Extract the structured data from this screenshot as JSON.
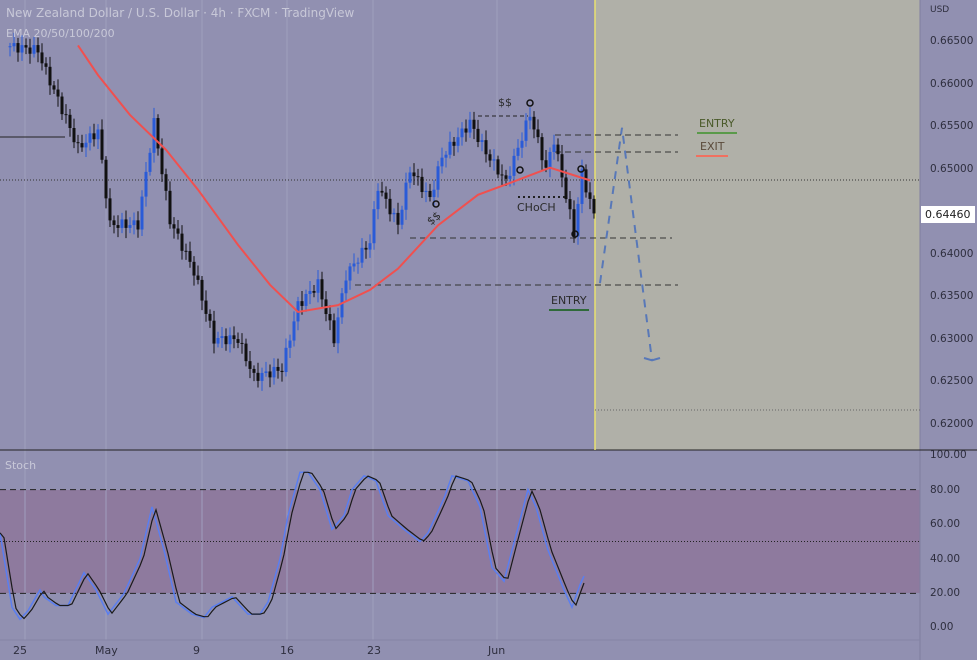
{
  "header": {
    "title": "New Zealand Dollar / U.S. Dollar · 4h · FXCM · TradingView",
    "indicator": "EMA 20/50/100/200"
  },
  "price_axis": {
    "currency": "USD",
    "ticks": [
      "0.66500",
      "0.66000",
      "0.65500",
      "0.65000",
      "0.64000",
      "0.63500",
      "0.63000",
      "0.62500",
      "0.62000"
    ],
    "current_price": "0.64460"
  },
  "stoch_axis": {
    "title": "Stoch",
    "ticks": [
      "100.00",
      "80.00",
      "60.00",
      "40.00",
      "20.00",
      "0.00"
    ]
  },
  "date_axis": [
    "25",
    "May",
    "9",
    "16",
    "23",
    "Jun"
  ],
  "annotations": {
    "ss_top": "$$",
    "ss_low": "$$",
    "choch": "CHoCH",
    "entry_upper": "ENTRY",
    "exit": "EXIT",
    "entry_lower": "ENTRY"
  },
  "colors": {
    "bull": "#2a5bd7",
    "bear": "#111111",
    "ema": "#f0504f",
    "stoch_k": "#5a7ef0",
    "stoch_d": "#1a1a1a",
    "forecast": "#5878b8",
    "entry": "#3a7a3a",
    "exit": "#f07060"
  },
  "chart_data": {
    "type": "candlestick",
    "symbol": "NZDUSD",
    "price_range": [
      0.618,
      0.668
    ],
    "close_keypoints": [
      [
        0,
        0.6645
      ],
      [
        7,
        0.664
      ],
      [
        9,
        0.6615
      ],
      [
        14,
        0.656
      ],
      [
        17,
        0.6525
      ],
      [
        22,
        0.6545
      ],
      [
        25,
        0.6435
      ],
      [
        32,
        0.6435
      ],
      [
        36,
        0.6555
      ],
      [
        40,
        0.644
      ],
      [
        46,
        0.638
      ],
      [
        51,
        0.63
      ],
      [
        57,
        0.63
      ],
      [
        61,
        0.6255
      ],
      [
        68,
        0.6265
      ],
      [
        72,
        0.634
      ],
      [
        77,
        0.6365
      ],
      [
        81,
        0.63
      ],
      [
        84,
        0.6375
      ],
      [
        90,
        0.6415
      ],
      [
        92,
        0.648
      ],
      [
        97,
        0.6435
      ],
      [
        100,
        0.65
      ],
      [
        105,
        0.6465
      ],
      [
        108,
        0.6515
      ],
      [
        115,
        0.6555
      ],
      [
        119,
        0.652
      ],
      [
        124,
        0.6485
      ],
      [
        130,
        0.6565
      ],
      [
        134,
        0.65
      ],
      [
        136,
        0.6535
      ],
      [
        141,
        0.6425
      ],
      [
        143,
        0.6495
      ],
      [
        146,
        0.6446
      ]
    ],
    "ema_keypoints": [
      [
        17,
        0.6646
      ],
      [
        22,
        0.6611
      ],
      [
        30,
        0.6564
      ],
      [
        39,
        0.6523
      ],
      [
        47,
        0.6476
      ],
      [
        57,
        0.6411
      ],
      [
        65,
        0.6364
      ],
      [
        72,
        0.6332
      ],
      [
        82,
        0.634
      ],
      [
        90,
        0.6358
      ],
      [
        97,
        0.6383
      ],
      [
        107,
        0.6434
      ],
      [
        117,
        0.647
      ],
      [
        125,
        0.6484
      ],
      [
        135,
        0.6502
      ],
      [
        145,
        0.6487
      ]
    ],
    "stoch_k_keypoints": [
      [
        0,
        55
      ],
      [
        3,
        12
      ],
      [
        5,
        5
      ],
      [
        7,
        10
      ],
      [
        10,
        22
      ],
      [
        11,
        18
      ],
      [
        14,
        13
      ],
      [
        17,
        13
      ],
      [
        21,
        32
      ],
      [
        24,
        22
      ],
      [
        27,
        8
      ],
      [
        31,
        20
      ],
      [
        35,
        40
      ],
      [
        38,
        70
      ],
      [
        41,
        45
      ],
      [
        44,
        15
      ],
      [
        48,
        8
      ],
      [
        51,
        6
      ],
      [
        53,
        12
      ],
      [
        58,
        18
      ],
      [
        62,
        8
      ],
      [
        65,
        8
      ],
      [
        67,
        15
      ],
      [
        70,
        40
      ],
      [
        72,
        65
      ],
      [
        75,
        90
      ],
      [
        77,
        90
      ],
      [
        80,
        80
      ],
      [
        83,
        57
      ],
      [
        86,
        65
      ],
      [
        88,
        80
      ],
      [
        91,
        88
      ],
      [
        94,
        85
      ],
      [
        97,
        65
      ],
      [
        101,
        57
      ],
      [
        105,
        50
      ],
      [
        107,
        55
      ],
      [
        111,
        75
      ],
      [
        113,
        88
      ],
      [
        117,
        85
      ],
      [
        120,
        70
      ],
      [
        123,
        35
      ],
      [
        126,
        27
      ],
      [
        128,
        45
      ],
      [
        132,
        80
      ],
      [
        134,
        70
      ],
      [
        137,
        45
      ],
      [
        141,
        22
      ],
      [
        143,
        12
      ],
      [
        145,
        25
      ],
      [
        146,
        30
      ]
    ],
    "levels": {
      "overbought": 80,
      "mid": 50,
      "oversold": 20
    },
    "horizontal_levels": [
      0.6553,
      0.6534,
      0.6487,
      0.6432,
      0.6365,
      0.6214
    ],
    "forecast_path": [
      0.6366,
      0.6549,
      0.6275
    ]
  }
}
